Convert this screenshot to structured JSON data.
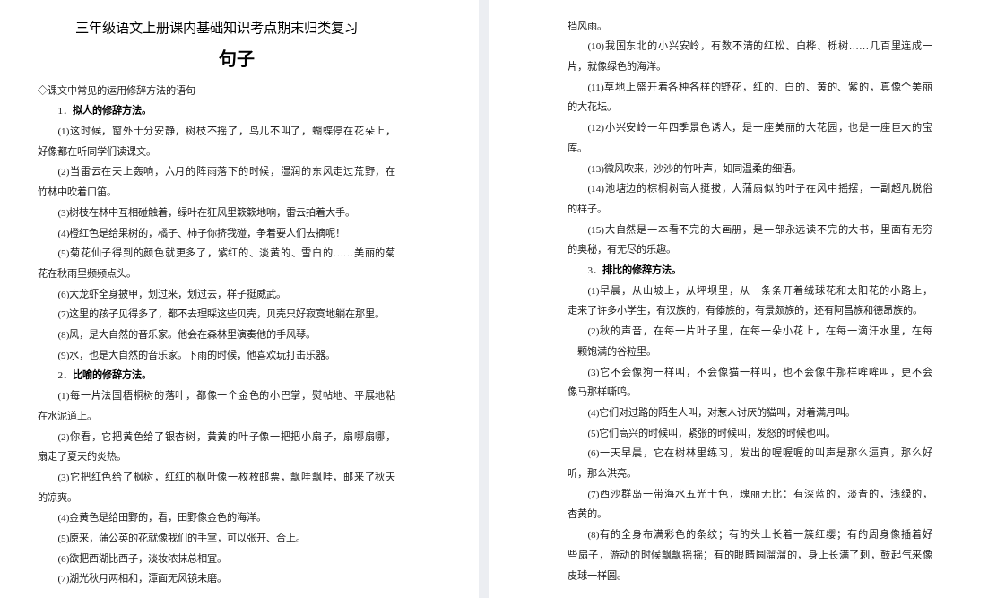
{
  "document": {
    "pages": [
      {
        "title": "三年级语文上册课内基础知识考点期末归类复习",
        "subtitle": "句子",
        "blocks": [
          {
            "kind": "section",
            "text": "◇课文中常见的运用修辞方法的语句"
          },
          {
            "kind": "heading",
            "text": "1．**拟人的修辞方法。**"
          },
          {
            "kind": "item",
            "lines": [
              "(1)这时候，窗外十分安静，树枝不摇了，鸟儿不叫了，蝴蝶停在花朵上，",
              "好像都在听同学们读课文。"
            ]
          },
          {
            "kind": "item",
            "lines": [
              "(2)当雷云在天上轰响，六月的阵雨落下的时候，湿润的东风走过荒野，在",
              "竹林中吹着口笛。"
            ]
          },
          {
            "kind": "item",
            "lines": [
              "(3)树枝在林中互相碰触着，绿叶在狂风里簌簌地响，雷云拍着大手。"
            ]
          },
          {
            "kind": "item",
            "lines": [
              "(4)橙红色是给果树的，橘子、柿子你挤我碰，争着要人们去摘呢！"
            ]
          },
          {
            "kind": "item",
            "lines": [
              "(5)菊花仙子得到的颜色就更多了，紫红的、淡黄的、雪白的……美丽的菊",
              "花在秋雨里频频点头。"
            ]
          },
          {
            "kind": "item",
            "lines": [
              "(6)大龙虾全身披甲，划过来，划过去，样子挺威武。"
            ]
          },
          {
            "kind": "item",
            "lines": [
              "(7)这里的孩子见得多了，都不去理睬这些贝壳，贝壳只好寂寞地躺在那里。"
            ]
          },
          {
            "kind": "item",
            "lines": [
              "(8)风，是大自然的音乐家。他会在森林里演奏他的手风琴。"
            ]
          },
          {
            "kind": "item",
            "lines": [
              "(9)水，也是大自然的音乐家。下雨的时候，他喜欢玩打击乐器。"
            ]
          },
          {
            "kind": "heading",
            "text": "2．**比喻的修辞方法。**"
          },
          {
            "kind": "item",
            "lines": [
              "(1)每一片法国梧桐树的落叶，都像一个金色的小巴掌，熨帖地、平展地粘",
              "在水泥道上。"
            ]
          },
          {
            "kind": "item",
            "lines": [
              "(2)你看，它把黄色给了银杏树，黄黄的叶子像一把把小扇子，扇哪扇哪，",
              "扇走了夏天的炎热。"
            ]
          },
          {
            "kind": "item",
            "lines": [
              "(3)它把红色给了枫树，红红的枫叶像一枚枚邮票，飘哇飘哇，邮来了秋天",
              "的凉爽。"
            ]
          },
          {
            "kind": "item",
            "lines": [
              "(4)金黄色是给田野的，看，田野像金色的海洋。"
            ]
          },
          {
            "kind": "item",
            "lines": [
              "(5)原来，蒲公英的花就像我们的手掌，可以张开、合上。"
            ]
          },
          {
            "kind": "item",
            "lines": [
              "(6)欲把西湖比西子，淡妆浓抹总相宜。"
            ]
          },
          {
            "kind": "item",
            "lines": [
              "(7)湖光秋月两相和，潭面无风镜未磨。"
            ]
          }
        ]
      },
      {
        "blocks": [
          {
            "kind": "continuation",
            "lines": [
              "挡风雨。"
            ]
          },
          {
            "kind": "item",
            "lines": [
              "(10)我国东北的小兴安岭，有数不清的红松、白桦、栎树……几百里连成一",
              "片，就像绿色的海洋。"
            ]
          },
          {
            "kind": "item",
            "lines": [
              "(11)草地上盛开着各种各样的野花，红的、白的、黄的、紫的，真像个美丽",
              "的大花坛。"
            ]
          },
          {
            "kind": "item",
            "lines": [
              "(12)小兴安岭一年四季景色诱人，是一座美丽的大花园，也是一座巨大的宝",
              "库。"
            ]
          },
          {
            "kind": "item",
            "lines": [
              "(13)微风吹来，沙沙的竹叶声，如同温柔的细语。"
            ]
          },
          {
            "kind": "item",
            "lines": [
              "(14)池塘边的棕榈树高大挺拔，大蒲扇似的叶子在风中摇摆，一副超凡脱俗",
              "的样子。"
            ]
          },
          {
            "kind": "item",
            "lines": [
              "(15)大自然是一本看不完的大画册，是一部永远读不完的大书，里面有无穷",
              "的奥秘，有无尽的乐趣。"
            ]
          },
          {
            "kind": "heading",
            "text": "3．**排比的修辞方法。**"
          },
          {
            "kind": "item",
            "lines": [
              "(1)早晨，从山坡上，从坪坝里，从一条条开着绒球花和太阳花的小路上，",
              "走来了许多小学生，有汉族的，有傣族的，有景颇族的，还有阿昌族和德昂族的。"
            ]
          },
          {
            "kind": "item",
            "lines": [
              "(2)秋的声音，在每一片叶子里，在每一朵小花上，在每一滴汗水里，在每",
              "一颗饱满的谷粒里。"
            ]
          },
          {
            "kind": "item",
            "lines": [
              "(3)它不会像狗一样叫，不会像猫一样叫，也不会像牛那样哞哞叫，更不会",
              "像马那样嘶鸣。"
            ]
          },
          {
            "kind": "item",
            "lines": [
              "(4)它们对过路的陌生人叫，对惹人讨厌的猫叫，对着满月叫。"
            ]
          },
          {
            "kind": "item",
            "lines": [
              "(5)它们高兴的时候叫，紧张的时候叫，发怒的时候也叫。"
            ]
          },
          {
            "kind": "item",
            "lines": [
              "(6)一天早晨，它在树林里练习，发出的喔喔喔的叫声是那么逼真，那么好",
              "听，那么洪亮。"
            ]
          },
          {
            "kind": "item",
            "lines": [
              "(7)西沙群岛一带海水五光十色，瑰丽无比：有深蓝的，淡青的，浅绿的，",
              "杏黄的。"
            ]
          },
          {
            "kind": "item",
            "lines": [
              "(8)有的全身布满彩色的条纹；有的头上长着一簇红缨；有的周身像插着好",
              "些扇子，游动的时候飘飘摇摇；有的眼睛圆溜溜的，身上长满了刺，鼓起气来像",
              "皮球一样圆。"
            ]
          }
        ]
      }
    ]
  }
}
